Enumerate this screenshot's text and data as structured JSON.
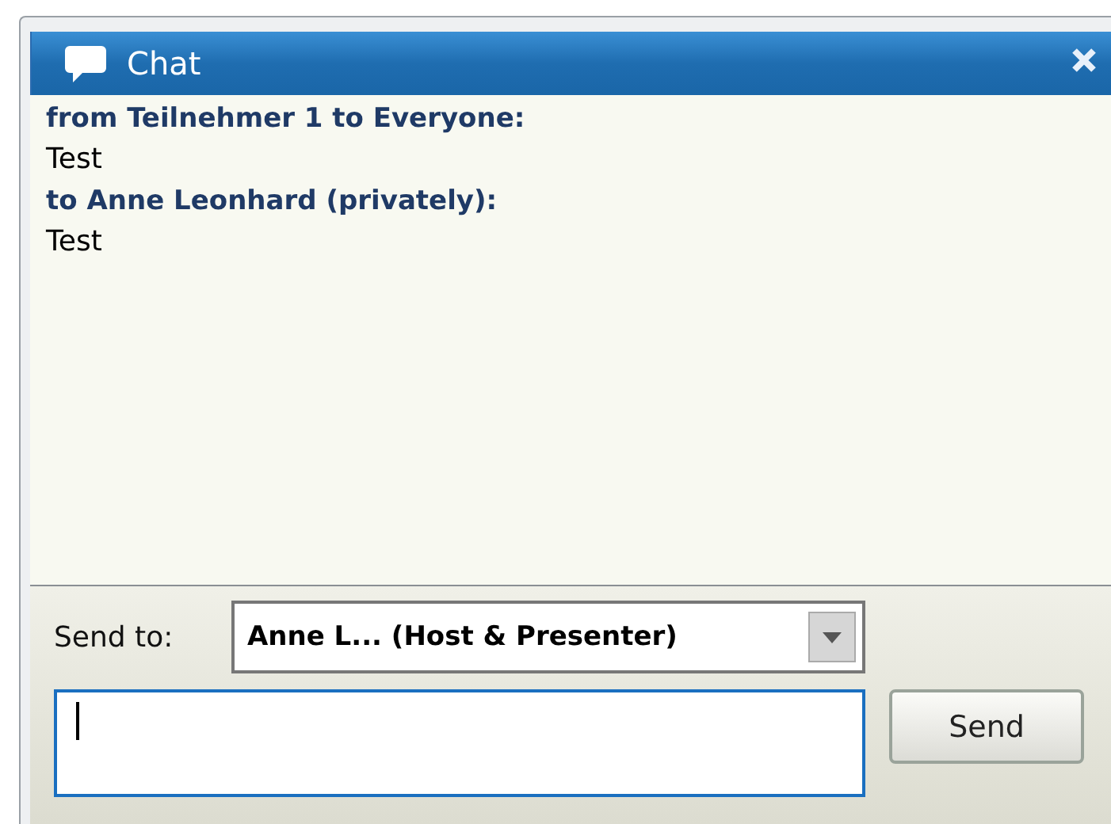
{
  "window": {
    "title": "Chat"
  },
  "messages": [
    {
      "header": "from Teilnehmer 1 to Everyone:",
      "text": "Test"
    },
    {
      "header": "to Anne Leonhard  (privately):",
      "text": "Test"
    }
  ],
  "send_to": {
    "label": "Send to:",
    "value": "Anne L...  (Host & Presenter)"
  },
  "message_field": {
    "focused": true
  },
  "send_button": "Send"
}
